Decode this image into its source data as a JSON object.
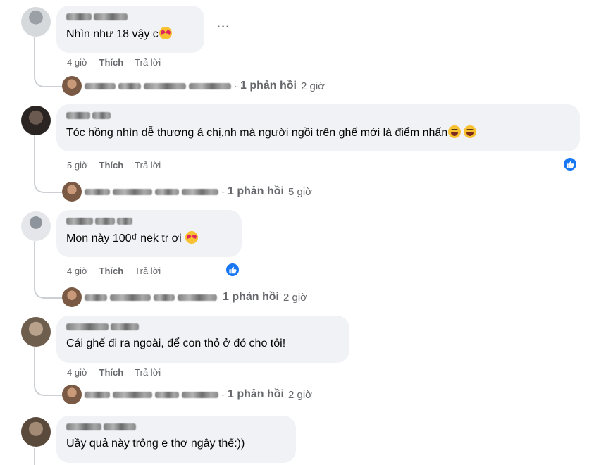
{
  "colors": {
    "bubble": "#f0f2f5",
    "meta": "#65676b",
    "like_blue": "#1877f2",
    "thread": "#ccd0d5"
  },
  "icons": {
    "more": "more-options-icon",
    "like": "like-reaction-icon",
    "love_emoji": "heart-eyes-emoji",
    "laugh_emoji": "grinning-squint-emoji"
  },
  "comments": [
    {
      "text": "Nhìn như 18 vậy c",
      "time": "4 giờ",
      "like_label": "Thích",
      "reply_label": "Trả lời",
      "more": "···",
      "reply_summary": {
        "dot": "·",
        "count": "1 phản hồi",
        "time": "2 giờ"
      }
    },
    {
      "text": "Tóc hồng nhìn dễ thương á chị,nh mà người ngồi trên ghế mới là điểm nhấn",
      "time": "5 giờ",
      "like_label": "Thích",
      "reply_label": "Trả lời",
      "reactions": 1,
      "reply_summary": {
        "dot": "·",
        "count": "1 phản hồi",
        "time": "5 giờ"
      }
    },
    {
      "text": "Mon này 100₫ nek tr ơi",
      "time": "4 giờ",
      "like_label": "Thích",
      "reply_label": "Trả lời",
      "reactions": 1,
      "reply_summary": {
        "dot": "",
        "count": "1 phản hồi",
        "time": "2 giờ"
      }
    },
    {
      "text": "Cái ghế đi ra ngoài, để con thỏ ở đó cho tôi!",
      "time": "4 giờ",
      "like_label": "Thích",
      "reply_label": "Trả lời",
      "reply_summary": {
        "dot": "·",
        "count": "1 phản hồi",
        "time": "2 giờ"
      }
    },
    {
      "text": "Uầy quả này trông e thơ ngây thế:))"
    }
  ]
}
